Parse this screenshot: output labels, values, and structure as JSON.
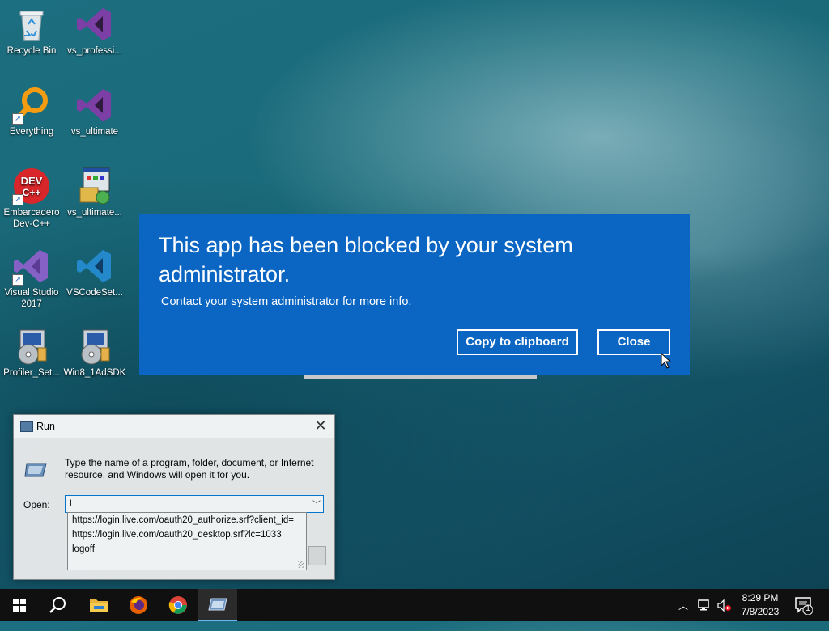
{
  "desktop": {
    "icons": [
      {
        "label": "Recycle Bin",
        "icon": "recycle-bin-icon"
      },
      {
        "label": "vs_professi...",
        "icon": "visual-studio-icon"
      },
      {
        "label": "Everything",
        "icon": "everything-search-icon"
      },
      {
        "label": "vs_ultimate",
        "icon": "visual-studio-icon"
      },
      {
        "label": "Embarcadero Dev-C++",
        "icon": "dev-cpp-icon"
      },
      {
        "label": "vs_ultimate...",
        "icon": "installer-icon"
      },
      {
        "label": "Visual Studio 2017",
        "icon": "visual-studio-2017-icon"
      },
      {
        "label": "VSCodeSet...",
        "icon": "vscode-icon"
      },
      {
        "label": "Profiler_Set...",
        "icon": "setup-cd-icon"
      },
      {
        "label": "Win8_1AdSDK",
        "icon": "setup-cd-icon"
      }
    ]
  },
  "blocked_dialog": {
    "title": "This app has been blocked by your system administrator.",
    "message": "Contact your system administrator for more info.",
    "copy_button": "Copy to clipboard",
    "close_button": "Close",
    "background_color": "#0a66c2"
  },
  "run_dialog": {
    "title": "Run",
    "description": "Type the name of a program, folder, document, or Internet resource, and Windows will open it for you.",
    "open_label": "Open:",
    "open_value": "l",
    "history": [
      "https://login.live.com/oauth20_authorize.srf?client_id=",
      "https://login.live.com/oauth20_desktop.srf?lc=1033",
      "logoff"
    ]
  },
  "taskbar": {
    "apps": [
      "start-icon",
      "search-icon",
      "file-explorer-icon",
      "firefox-icon",
      "chrome-icon",
      "run-icon"
    ],
    "tray_icons": [
      "chevron-up-icon",
      "network-icon",
      "volume-muted-icon"
    ],
    "time": "8:29 PM",
    "date": "7/8/2023",
    "notification_count": "1",
    "accent_color": "#6fb3f2"
  }
}
